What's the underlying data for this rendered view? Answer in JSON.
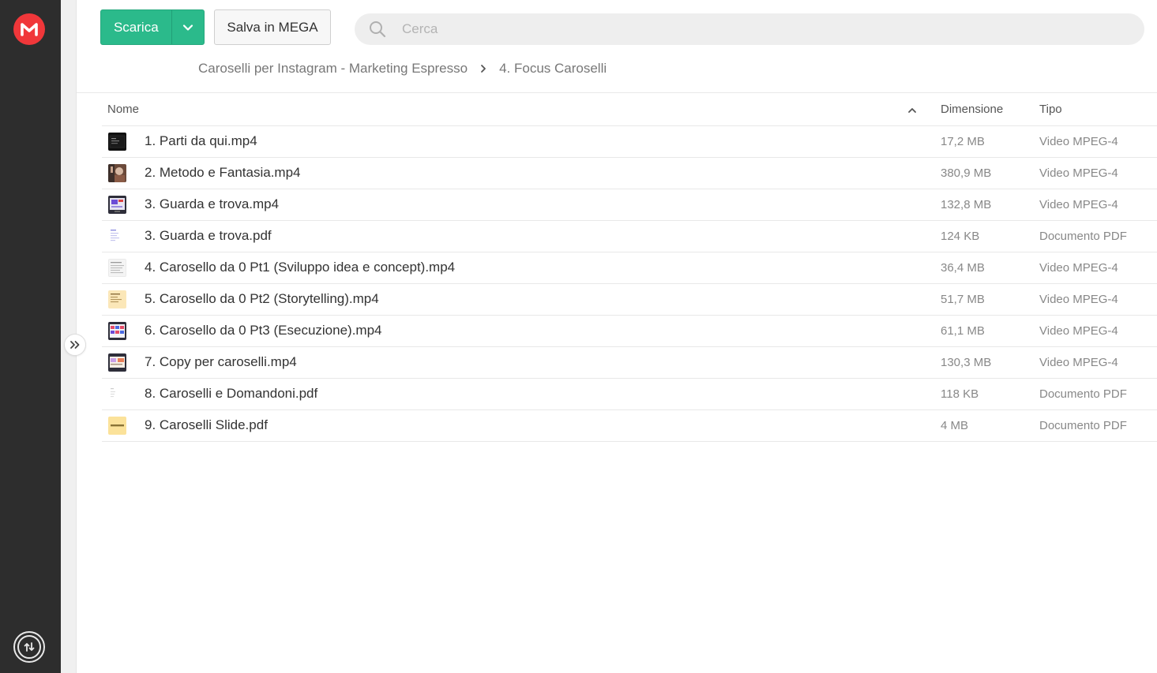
{
  "toolbar": {
    "download_label": "Scarica",
    "save_label": "Salva in MEGA"
  },
  "search": {
    "placeholder": "Cerca"
  },
  "breadcrumb": {
    "items": [
      "Caroselli per Instagram - Marketing Espresso",
      "4. Focus Caroselli"
    ]
  },
  "table": {
    "columns": {
      "name": "Nome",
      "size": "Dimensione",
      "type": "Tipo"
    },
    "rows": [
      {
        "name": "1. Parti da qui.mp4",
        "size": "17,2 MB",
        "type": "Video MPEG-4",
        "thumb": "dark"
      },
      {
        "name": "2. Metodo e Fantasia.mp4",
        "size": "380,9 MB",
        "type": "Video MPEG-4",
        "thumb": "photo"
      },
      {
        "name": "3. Guarda e trova.mp4",
        "size": "132,8 MB",
        "type": "Video MPEG-4",
        "thumb": "screen-purple"
      },
      {
        "name": "3. Guarda e trova.pdf",
        "size": "124 KB",
        "type": "Documento PDF",
        "thumb": "doc-blue"
      },
      {
        "name": "4. Carosello da 0 Pt1 (Sviluppo idea e concept).mp4",
        "size": "36,4 MB",
        "type": "Video MPEG-4",
        "thumb": "doc-gray"
      },
      {
        "name": "5. Carosello da 0 Pt2 (Storytelling).mp4",
        "size": "51,7 MB",
        "type": "Video MPEG-4",
        "thumb": "note-yellow"
      },
      {
        "name": "6. Carosello da 0 Pt3 (Esecuzione).mp4",
        "size": "61,1 MB",
        "type": "Video MPEG-4",
        "thumb": "grid-color"
      },
      {
        "name": "7. Copy per caroselli.mp4",
        "size": "130,3 MB",
        "type": "Video MPEG-4",
        "thumb": "slides"
      },
      {
        "name": "8. Caroselli e Domandoni.pdf",
        "size": "118 KB",
        "type": "Documento PDF",
        "thumb": "blank"
      },
      {
        "name": "9. Caroselli Slide.pdf",
        "size": "4 MB",
        "type": "Documento PDF",
        "thumb": "yellow-card"
      }
    ]
  },
  "colors": {
    "accent_green": "#2bba8b",
    "logo_red": "#f0373a",
    "rail": "#2d2d2d"
  },
  "icons": {
    "logo": "mega-logo-icon",
    "caret": "chevron-down-icon",
    "search": "search-icon",
    "breadcrumb_sep": "chevron-right-icon",
    "sort": "chevron-up-icon",
    "expand": "double-chevron-right-icon",
    "transfers": "transfer-arrows-icon"
  }
}
